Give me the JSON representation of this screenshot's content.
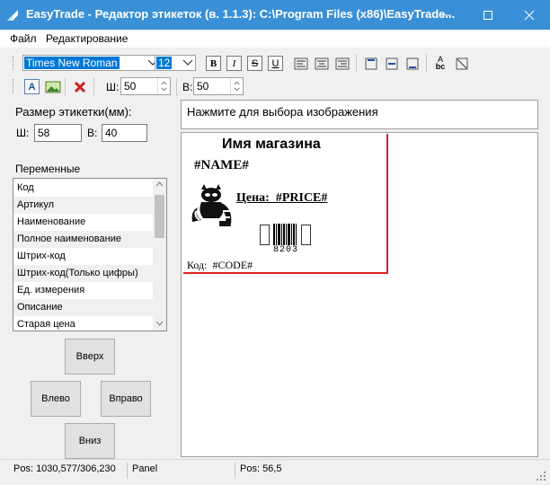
{
  "window": {
    "title": "EasyTrade - Редактор этикеток (в. 1.1.3): C:\\Program Files (x86)\\EasyTrade...",
    "accent": "#3a90d6"
  },
  "menu": [
    "Файл",
    "Редактирование"
  ],
  "toolbar1": {
    "font_name": "Times New Roman",
    "font_size": "12",
    "bold": "B",
    "italic": "I",
    "strike": "S",
    "underline": "U",
    "rotate_label": "A",
    "rotate_sub": "bc"
  },
  "toolbar2": {
    "width_label": "Ш:",
    "width_value": "50",
    "height_label": "В:",
    "height_value": "50",
    "text_btn": "A"
  },
  "label_size": {
    "title": "Размер этикетки(мм):",
    "width_label": "Ш:",
    "width_value": "58",
    "height_label": "В:",
    "height_value": "40"
  },
  "variables": {
    "title": "Переменные",
    "items": [
      "Код",
      "Артикул",
      "Наименование",
      "Полное наименование",
      "Штрих-код",
      "Штрих-код(Только цифры)",
      "Ед. измерения",
      "Описание",
      "Старая цена"
    ]
  },
  "buttons": {
    "up": "Вверх",
    "left": "Влево",
    "right": "Вправо",
    "down": "Вниз"
  },
  "image_prompt": "Нажмите для выбора изображения",
  "label": {
    "shop_name": "Имя магазина",
    "name_var": "#NAME#",
    "price_text": "Цена:  #PRICE#",
    "barcode_number": "8203",
    "code_text": "Код:  #CODE#"
  },
  "status": {
    "pos1": "Pos: 1030,577/306,230",
    "panel": "Panel",
    "pos2": "Pos: 56,5"
  }
}
